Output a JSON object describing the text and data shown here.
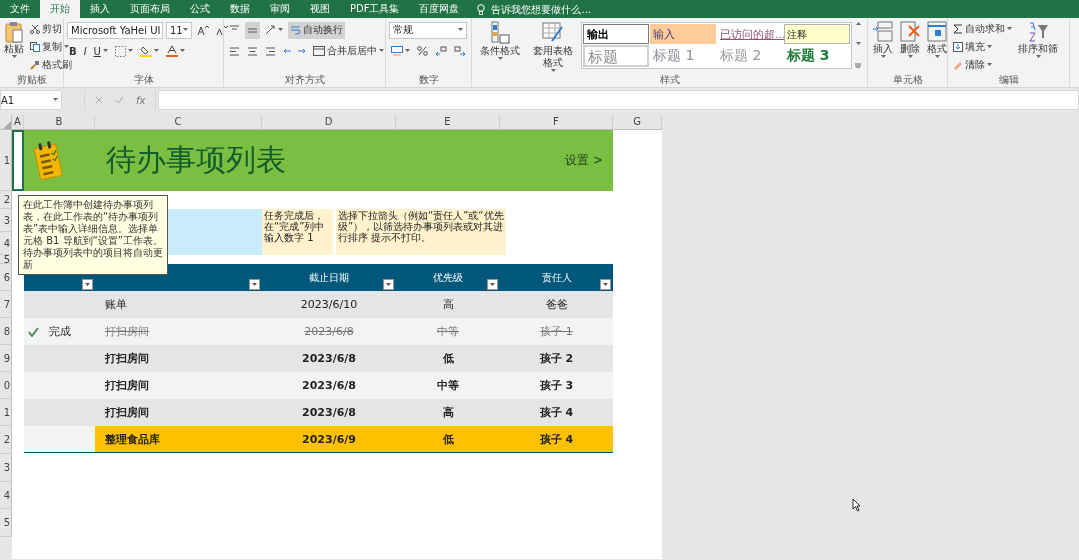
{
  "menu_tabs": [
    {
      "label": "文件",
      "selected": false
    },
    {
      "label": "开始",
      "selected": true
    },
    {
      "label": "插入",
      "selected": false
    },
    {
      "label": "页面布局",
      "selected": false
    },
    {
      "label": "公式",
      "selected": false
    },
    {
      "label": "数据",
      "selected": false
    },
    {
      "label": "审阅",
      "selected": false
    },
    {
      "label": "视图",
      "selected": false
    },
    {
      "label": "PDF工具集",
      "selected": false
    },
    {
      "label": "百度网盘",
      "selected": false
    }
  ],
  "tell_me": {
    "placeholder": "告诉我您想要做什么..."
  },
  "ribbon": {
    "clipboard": {
      "label": "剪贴板",
      "paste": "粘贴",
      "cut": "剪切",
      "copy": "复制",
      "format_painter": "格式刷"
    },
    "font": {
      "label": "字体",
      "font_name": "Microsoft YaHei UI",
      "font_size": "11",
      "bold": "B",
      "italic": "I",
      "underline": "U"
    },
    "alignment": {
      "label": "对齐方式",
      "wrap_text": "自动换行",
      "wrap_on": true,
      "merge": "合并后居中"
    },
    "number": {
      "label": "数字",
      "format": "常规"
    },
    "format_buttons": [
      "条件格式",
      "套用表格格式"
    ],
    "styles": {
      "label": "样式",
      "cells": [
        {
          "label": "输出",
          "kind": "output"
        },
        {
          "label": "输入",
          "kind": "input"
        },
        {
          "label": "已访问的超...",
          "kind": "visited"
        },
        {
          "label": "注释",
          "kind": "note"
        },
        {
          "label": "标题",
          "kind": "heading"
        },
        {
          "label": "标题 1",
          "kind": "h1"
        },
        {
          "label": "标题 2",
          "kind": "h2"
        },
        {
          "label": "标题 3",
          "kind": "h3"
        }
      ]
    },
    "cells": {
      "label": "单元格",
      "buttons": [
        "插入",
        "删除",
        "格式"
      ]
    },
    "editing": {
      "label": "编辑",
      "autosum": "自动求和",
      "fill": "填充",
      "clear": "清除",
      "sort": "排序和筛"
    }
  },
  "formula_bar": {
    "name_box": "A1",
    "fx": "fx"
  },
  "column_headers": [
    "A",
    "B",
    "C",
    "D",
    "E",
    "F",
    "G"
  ],
  "row_headers": [
    "1",
    "2",
    "3",
    "4",
    "5",
    "6",
    "7",
    "8",
    "9",
    "0",
    "1",
    "2",
    "3",
    "4",
    "5"
  ],
  "sheet": {
    "title": "待办事项列表",
    "settings_link": "设置 >",
    "tooltip": "在此工作簿中创建待办事项列表，在此工作表的“待办事项列表”表中输入详细信息。选择单元格 B1 导航到“设置”工作表。待办事项列表中的项目将自动更新",
    "notes": [
      "任务完成后，在“完成”列中输入数字 1",
      "选择下拉箭头（例如“责任人”或“优先级”），以筛选待办事项列表或对其进行排序 提示不打印。"
    ],
    "table": {
      "columns": [
        {
          "kind": "status"
        },
        {
          "kind": "task"
        },
        {
          "kind": "date",
          "label": "截止日期"
        },
        {
          "kind": "priority",
          "label": "优先级"
        },
        {
          "kind": "owner",
          "label": "责任人"
        }
      ],
      "rows": [
        {
          "done": false,
          "bold": false,
          "highlighted": false,
          "task": "账单",
          "due": "2023/6/10",
          "priority": "高",
          "owner": "爸爸"
        },
        {
          "done": true,
          "status": "完成",
          "bold": false,
          "highlighted": false,
          "task": "打扫房间",
          "due": "2023/6/8",
          "priority": "中等",
          "owner": "孩子 1"
        },
        {
          "done": false,
          "bold": true,
          "highlighted": false,
          "task": "打扫房间",
          "due": "2023/6/8",
          "priority": "低",
          "owner": "孩子 2"
        },
        {
          "done": false,
          "bold": true,
          "highlighted": false,
          "task": "打扫房间",
          "due": "2023/6/8",
          "priority": "中等",
          "owner": "孩子 3"
        },
        {
          "done": false,
          "bold": true,
          "highlighted": false,
          "task": "打扫房间",
          "due": "2023/6/8",
          "priority": "高",
          "owner": "孩子 4"
        },
        {
          "done": false,
          "bold": true,
          "highlighted": true,
          "task": "整理食品库",
          "due": "2023/6/9",
          "priority": "低",
          "owner": "孩子 4"
        }
      ]
    }
  }
}
